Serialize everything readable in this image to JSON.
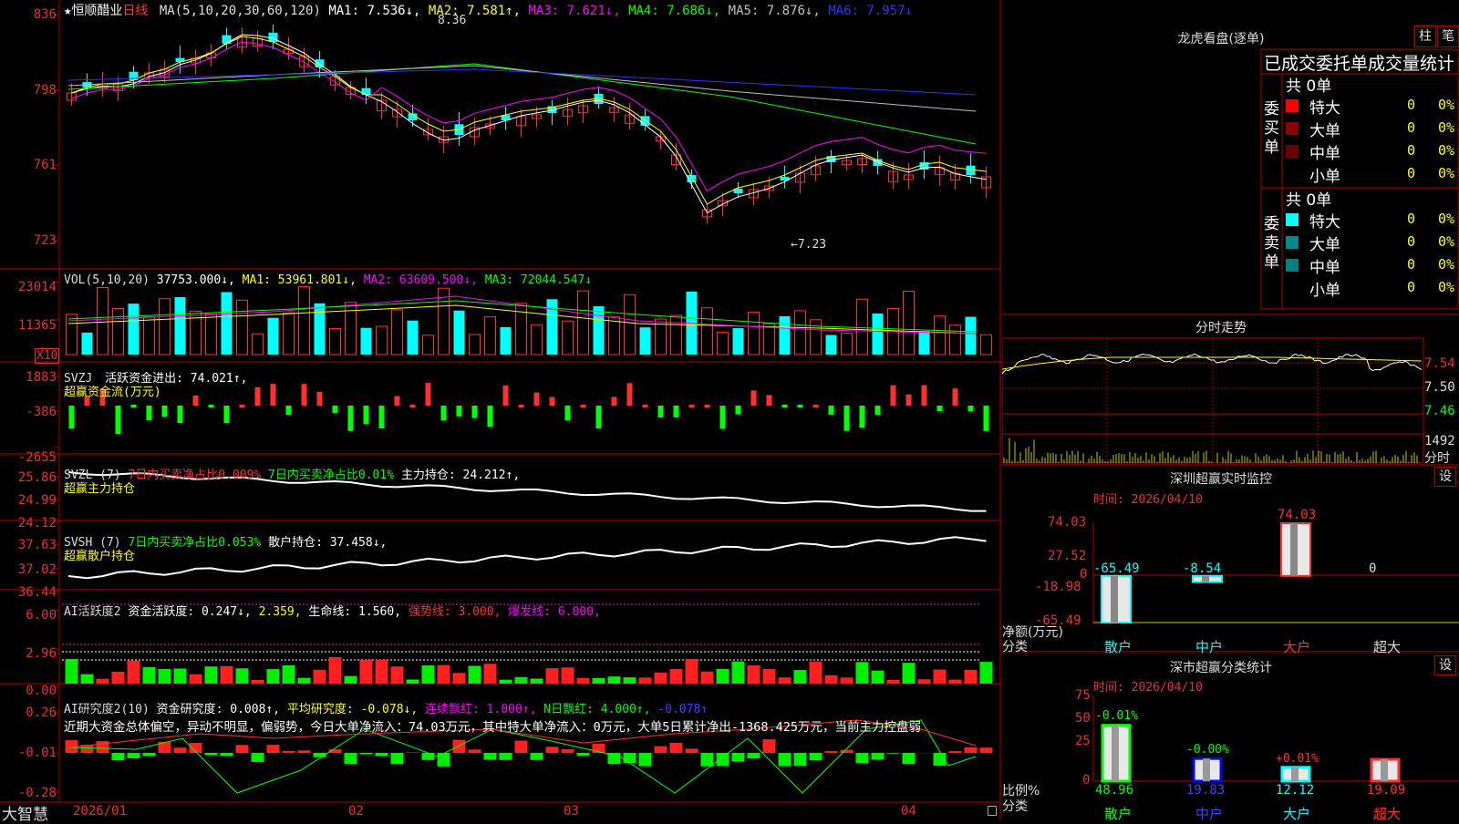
{
  "header": {
    "star": "★",
    "stock_name": "恒顺醋业",
    "period": "日线",
    "ma_label": "MA(5,10,20,30,60,120)",
    "ma": [
      {
        "name": "MA1: 7.536↓,",
        "color": "#ffffff"
      },
      {
        "name": "MA2: 7.581↑,",
        "color": "#ffff00"
      },
      {
        "name": "MA3: 7.621↓,",
        "color": "#ff00ff"
      },
      {
        "name": "MA4: 7.686↓,",
        "color": "#00ff00"
      },
      {
        "name": "MA5: 7.876↓,",
        "color": "#c0c0c0"
      },
      {
        "name": "MA6: 7.957↓",
        "color": "#3030ff"
      }
    ]
  },
  "price_panel": {
    "y_ticks": [
      "836",
      "798",
      "761",
      "723"
    ],
    "high_mark": "8.36",
    "low_mark": "←7.23"
  },
  "vol_panel": {
    "label": "VOL(5,10,20)",
    "value": "37753.000↓,",
    "ma1": "MA1: 53961.801↓,",
    "ma2": "MA2: 63609.500↓,",
    "ma3": "MA3: 72044.547↓",
    "y_ticks": [
      "23014",
      "11365"
    ],
    "unit": "X10"
  },
  "svzj_panel": {
    "label": "SVZJ",
    "title": "活跃资金进出: 74.021↑,",
    "sub": "超赢资金流(万元)",
    "y_ticks": [
      "1883",
      "-386",
      "-2655"
    ]
  },
  "svzl_panel": {
    "label": "SVZL (7)",
    "t1": "7日内买卖净占比0.009%",
    "t2": "7日内买卖净占比0.01%",
    "t3": "主力持仓: 24.212↑,",
    "sub": "超赢主力持仓",
    "y_ticks": [
      "25.86",
      "24.99",
      "24.12"
    ]
  },
  "svsh_panel": {
    "label": "SVSH (7)",
    "t1": "7日内买卖净占比0.053%",
    "t2": "散户持仓: 37.458↓,",
    "sub": "超赢散户持仓",
    "y_ticks": [
      "37.63",
      "37.02",
      "36.44"
    ]
  },
  "ai_active_panel": {
    "label": "AI活跃度2",
    "t1": "资金活跃度: 0.247↓,",
    "t2": "2.359,",
    "t3": "生命线: 1.560,",
    "t4": "强势线: 3.000,",
    "t5": "爆发线: 6.000,",
    "y_ticks": [
      "6.00",
      "2.96",
      "0.00"
    ]
  },
  "ai_research_panel": {
    "label": "AI研究度2(10)",
    "t1": "资金研究度: 0.008↑,",
    "t2": "平均研究度: -0.078↓,",
    "t3": "连续飘红: 1.000↑,",
    "t4": "N日飘红: 4.000↑,",
    "t5": "-0.078↑",
    "comment": "近期大资金总体偏空，异动不明显，偏弱势，今日大单净流入：74.03万元，其中特大单净流入：0万元，大单5日累计净出-1368.425万元，当前主力控盘弱",
    "y_ticks": [
      "0.26",
      "-0.01",
      "-0.28"
    ]
  },
  "bottom_bar": {
    "brand": "大智慧",
    "dates": [
      "2026/01",
      "02",
      "03",
      "04"
    ]
  },
  "dragon": {
    "title": "龙虎看盘(逐单)",
    "btn_zhu": "柱",
    "btn_bi": "笔",
    "table_title": "已成交委托单成交量统计",
    "buy_label": "委买单",
    "sell_label": "委卖单",
    "buy_total": "共 0单",
    "sell_total": "共 0单",
    "buy_rows": [
      {
        "name": "特大",
        "count": "0",
        "pct": "0%",
        "color": "#ff0000"
      },
      {
        "name": "大单",
        "count": "0",
        "pct": "0%",
        "color": "#8b0000"
      },
      {
        "name": "中单",
        "count": "0",
        "pct": "0%",
        "color": "#6a0000"
      },
      {
        "name": "小单",
        "count": "0",
        "pct": "0%",
        "color": "#000000"
      }
    ],
    "sell_rows": [
      {
        "name": "特大",
        "count": "0",
        "pct": "0%",
        "color": "#00ffff"
      },
      {
        "name": "大单",
        "count": "0",
        "pct": "0%",
        "color": "#008b8b"
      },
      {
        "name": "中单",
        "count": "0",
        "pct": "0%",
        "color": "#008080"
      },
      {
        "name": "小单",
        "count": "0",
        "pct": "0%",
        "color": "#000000"
      }
    ]
  },
  "intraday": {
    "title": "分时走势",
    "y_ticks": [
      "7.54",
      "7.50",
      "7.46"
    ],
    "vol_tick": "1492",
    "vol_unit": "分时"
  },
  "monitor": {
    "title": "深圳超赢实时监控",
    "btn": "设",
    "time": "时间: 2026/04/10",
    "y_ticks": [
      "74.03",
      "27.52",
      "0",
      "-18.98",
      "-65.49"
    ],
    "axis_label": "净额(万元)",
    "cat_label": "分类",
    "categories": [
      "散户",
      "中户",
      "大户",
      "超大"
    ],
    "values_text": [
      "-65.49",
      "-8.54",
      "74.03",
      "0"
    ]
  },
  "classify": {
    "title": "深市超赢分类统计",
    "btn": "设",
    "time": "时间: 2026/04/10",
    "y_ticks": [
      "75",
      "50",
      "25",
      "0"
    ],
    "axis_label": "比例%",
    "cat_label": "分类",
    "categories": [
      "散户",
      "中户",
      "大户",
      "超大"
    ],
    "top_text": [
      "-0.01%",
      "-0.00%",
      "+0.01%",
      ""
    ],
    "bottom_text": [
      "48.96",
      "19.83",
      "12.12",
      "19.09"
    ]
  },
  "chart_data": {
    "type": "bar",
    "title": "深圳超赢实时监控",
    "ylabel": "净额(万元)",
    "categories": [
      "散户",
      "中户",
      "大户",
      "超大"
    ],
    "values": [
      -65.49,
      -8.54,
      74.03,
      0
    ],
    "ylim": [
      -65.49,
      74.03
    ]
  }
}
